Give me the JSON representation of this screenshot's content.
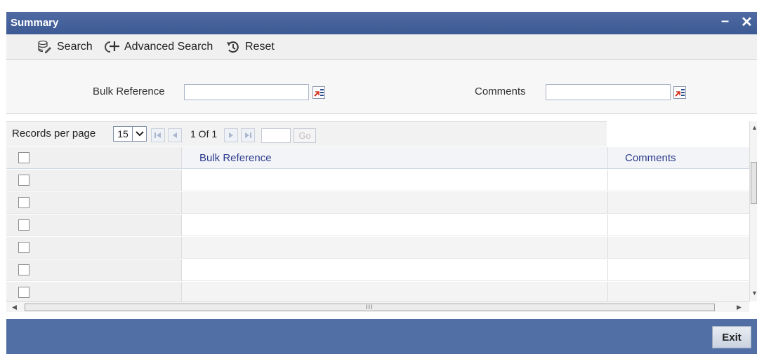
{
  "window": {
    "title": "Summary",
    "minimize": "–",
    "close": "✕"
  },
  "toolbar": {
    "search": "Search",
    "advanced_search": "Advanced Search",
    "reset": "Reset"
  },
  "criteria": {
    "bulk_reference_label": "Bulk Reference",
    "bulk_reference_value": "",
    "comments_label": "Comments",
    "comments_value": ""
  },
  "pager": {
    "records_per_page_label": "Records per page",
    "records_per_page_value": "15",
    "page_info": "1 Of 1",
    "goto_value": "",
    "go_label": "Go"
  },
  "grid": {
    "columns": [
      "Bulk Reference",
      "Comments"
    ],
    "rows": [
      {},
      {},
      {},
      {},
      {},
      {}
    ]
  },
  "scroll": {
    "hscroll_marker": "III"
  },
  "footer": {
    "exit_label": "Exit"
  },
  "colors": {
    "title_bar": "#3d5a94",
    "footer": "#516fa4",
    "header_text": "#2a3a8c"
  }
}
